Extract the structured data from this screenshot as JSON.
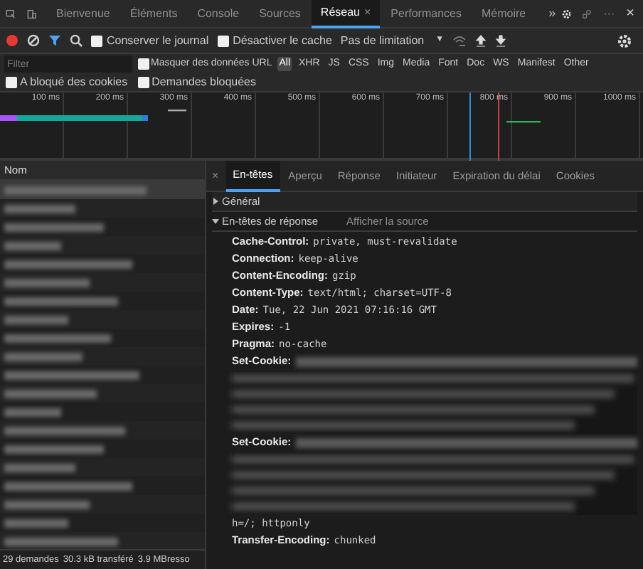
{
  "devtools_tabs": [
    {
      "label": "Bienvenue",
      "selected": false
    },
    {
      "label": "Éléments",
      "selected": false
    },
    {
      "label": "Console",
      "selected": false
    },
    {
      "label": "Sources",
      "selected": false
    },
    {
      "label": "Réseau",
      "selected": true,
      "close": "×"
    },
    {
      "label": "Performances",
      "selected": false
    },
    {
      "label": "Mémoire",
      "selected": false
    }
  ],
  "more_tabs": "»",
  "window_menu": "···",
  "window_close": "×",
  "toolbar": {
    "recording": true,
    "checkboxes": [
      {
        "label": "Conserver le journal",
        "checked": false
      },
      {
        "label": "Désactiver le cache",
        "checked": false
      }
    ],
    "throttling": "Pas de limitation",
    "throttling_caret": "▼"
  },
  "filter": {
    "placeholder": "Filter",
    "hide_data_urls": {
      "label": "Masquer des données URL",
      "checked": false
    },
    "types": [
      {
        "label": "All",
        "selected": true
      },
      {
        "label": "XHR",
        "selected": false
      },
      {
        "label": "JS",
        "selected": false
      },
      {
        "label": "CSS",
        "selected": false
      },
      {
        "label": "Img",
        "selected": false
      },
      {
        "label": "Media",
        "selected": false
      },
      {
        "label": "Font",
        "selected": false
      },
      {
        "label": "Doc",
        "selected": false
      },
      {
        "label": "WS",
        "selected": false
      },
      {
        "label": "Manifest",
        "selected": false
      },
      {
        "label": "Other",
        "selected": false
      }
    ]
  },
  "blocked_filters": [
    {
      "label": "A bloqué des cookies",
      "checked": false
    },
    {
      "label": "Demandes bloquées",
      "checked": false
    }
  ],
  "timeline_ticks": [
    "100 ms",
    "200 ms",
    "300 ms",
    "400 ms",
    "500 ms",
    "600 ms",
    "700 ms",
    "800 ms",
    "900 ms",
    "1000 ms"
  ],
  "requests": {
    "column": "Nom"
  },
  "status_bar": [
    "29 demandes",
    "30.3 kB transféré",
    "3.9 MBresso"
  ],
  "detail": {
    "close": "×",
    "tabs": [
      {
        "label": "En-têtes",
        "selected": true
      },
      {
        "label": "Aperçu",
        "selected": false
      },
      {
        "label": "Réponse",
        "selected": false
      },
      {
        "label": "Initiateur",
        "selected": false
      },
      {
        "label": "Expiration du délai",
        "selected": false
      },
      {
        "label": "Cookies",
        "selected": false
      }
    ],
    "sections": [
      {
        "title": "Général",
        "expanded": false
      },
      {
        "title": "En-têtes de réponse",
        "expanded": true,
        "link": "Afficher la source",
        "headers": [
          {
            "name": "Cache-Control:",
            "value": "private, must-revalidate",
            "redacted": false
          },
          {
            "name": "Connection:",
            "value": "keep-alive",
            "redacted": false
          },
          {
            "name": "Content-Encoding:",
            "value": "gzip",
            "redacted": false
          },
          {
            "name": "Content-Type:",
            "value": "text/html; charset=UTF-8",
            "redacted": false
          },
          {
            "name": "Date:",
            "value": "Tue, 22 Jun 2021 07:16:16 GMT",
            "redacted": false
          },
          {
            "name": "Expires:",
            "value": "-1",
            "redacted": false
          },
          {
            "name": "Pragma:",
            "value": "no-cache",
            "redacted": false
          },
          {
            "name": "Set-Cookie:",
            "redacted": true
          },
          {
            "name": "Set-Cookie:",
            "redacted": true,
            "value_tail": "h=/; httponly"
          },
          {
            "name": "Transfer-Encoding:",
            "value": "chunked",
            "redacted": false
          }
        ]
      }
    ]
  }
}
